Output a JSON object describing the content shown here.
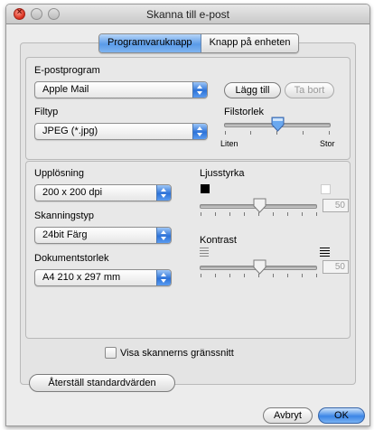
{
  "window": {
    "title": "Skanna till e-post"
  },
  "tabs": [
    {
      "label": "Programvaruknapp",
      "active": true
    },
    {
      "label": "Knapp på enheten",
      "active": false
    }
  ],
  "email": {
    "label": "E-postprogram",
    "value": "Apple Mail",
    "add_label": "Lägg till",
    "remove_label": "Ta bort"
  },
  "filetype": {
    "label": "Filtyp",
    "value": "JPEG (*.jpg)"
  },
  "filesize": {
    "label": "Filstorlek",
    "min_label": "Liten",
    "max_label": "Stor",
    "level_fraction": 0.5
  },
  "resolution": {
    "label": "Upplösning",
    "value": "200 x 200 dpi"
  },
  "scantype": {
    "label": "Skanningstyp",
    "value": "24bit Färg"
  },
  "docsize": {
    "label": "Dokumentstorlek",
    "value": "A4  210 x 297 mm"
  },
  "brightness": {
    "label": "Ljusstyrka",
    "value": "50"
  },
  "contrast": {
    "label": "Kontrast",
    "value": "50"
  },
  "show_interface": {
    "label": "Visa skannerns gränssnitt",
    "checked": false
  },
  "restore_label": "Återställ standardvärden",
  "cancel_label": "Avbryt",
  "ok_label": "OK",
  "colors": {
    "accent": "#3c86e6"
  }
}
